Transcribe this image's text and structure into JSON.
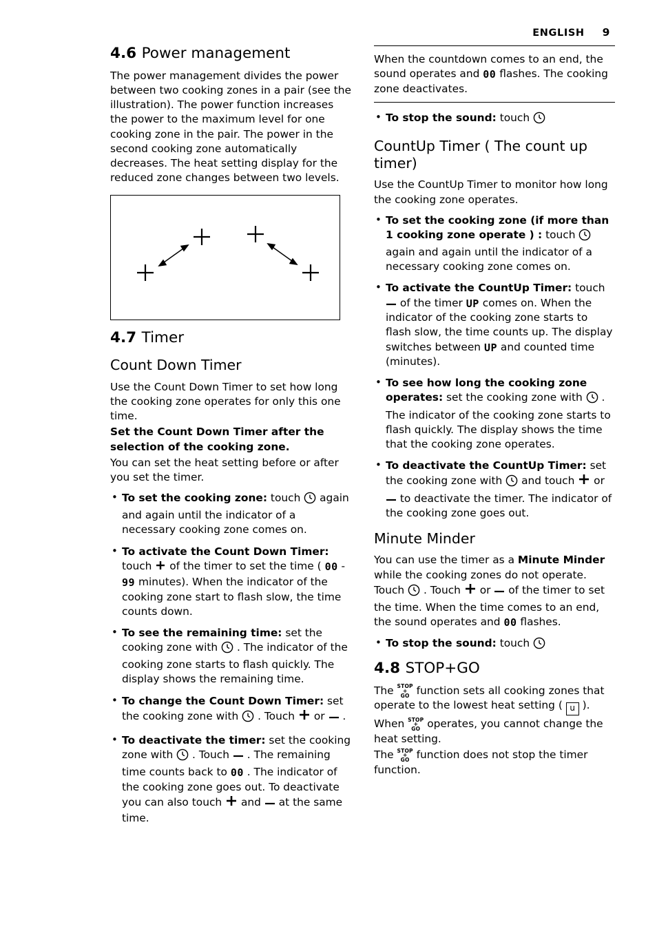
{
  "header": {
    "language": "ENGLISH",
    "page_number": "9"
  },
  "left_column": {
    "section_46": {
      "number": "4.6",
      "title": "Power management",
      "body": "The power management divides the power between two cooking zones in a pair (see the illustration). The power function increases the power to the maximum level for one cooking zone in the pair. The power in the second cooking zone automatically decreases. The heat setting display for the reduced zone changes between two levels.",
      "illustration_name": "power-management-diagram"
    },
    "section_47": {
      "number": "4.7",
      "title": "Timer",
      "subtitle": "Count Down Timer",
      "intro": "Use the Count Down Timer to set how long the cooking zone operates for only this one time.",
      "bold_note": "Set the Count Down Timer after the selection of the cooking zone.",
      "after_note": "You can set the heat setting before or after you set the timer.",
      "bullets": [
        {
          "lead": "To set the cooking zone:",
          "text_1": " touch ",
          "icon_1": "clock-icon",
          "text_2": " again and again until the indicator of a necessary cooking zone comes on."
        },
        {
          "lead": "To activate the Count Down Timer:",
          "text_1": " touch ",
          "icon_1": "plus-icon",
          "text_2": " of the timer to set the time ( ",
          "seg_1": "00",
          "text_3": " - ",
          "seg_2": "99",
          "text_4": " minutes). When the indicator of the cooking zone start to flash slow, the time counts down."
        },
        {
          "lead": "To see the remaining time:",
          "text_1": " set the cooking zone with ",
          "icon_1": "clock-icon",
          "text_2": " . The indicator of the cooking zone starts to flash quickly. The display shows the remaining time."
        },
        {
          "lead": "To change the Count Down Timer:",
          "text_1": " set the cooking zone with ",
          "icon_1": "clock-icon",
          "text_2": " . Touch ",
          "icon_2": "plus-icon",
          "text_3": " or ",
          "icon_3": "minus-icon",
          "text_4": " ."
        },
        {
          "lead": "To deactivate the timer:",
          "text_1": " set the cooking zone with ",
          "icon_1": "clock-icon",
          "text_2": " . Touch ",
          "icon_2": "minus-icon",
          "text_3": " . The remaining time counts back to ",
          "seg_1": "00",
          "text_4": " . The indicator of the cooking zone goes out. To deactivate you can also touch ",
          "icon_3": "plus-icon",
          "text_5": " and ",
          "icon_4": "minus-icon",
          "text_6": " at the same time."
        }
      ]
    }
  },
  "right_column": {
    "note_box": {
      "text_1": "When the countdown comes to an end, the sound operates and ",
      "seg": "00",
      "text_2": " flashes. The cooking zone deactivates."
    },
    "note_bullet": {
      "lead": "To stop the sound:",
      "text_1": " touch ",
      "icon_1": "clock-icon"
    },
    "countup": {
      "title": "CountUp Timer ( The count up timer)",
      "intro": "Use the CountUp Timer to monitor how long the cooking zone operates.",
      "bullets": [
        {
          "lead": "To set the cooking zone (if more than 1 cooking zone operate ) :",
          "text_1": " touch ",
          "icon_1": "clock-icon",
          "text_2": " again and again until the indicator of a necessary cooking zone comes on."
        },
        {
          "lead": "To activate the CountUp Timer:",
          "text_1": " touch ",
          "icon_1": "minus-icon",
          "text_2": " of the timer ",
          "seg_1": "UP",
          "text_3": " comes on. When the indicator of the cooking zone starts to flash slow, the time counts up. The display switches between ",
          "seg_2": "UP",
          "text_4": " and counted time (minutes)."
        },
        {
          "lead": "To see how long the cooking zone operates:",
          "text_1": " set the cooking zone with ",
          "icon_1": "clock-icon",
          "text_2": " . The indicator of the cooking zone starts to flash quickly. The display shows the time that the cooking zone operates."
        },
        {
          "lead": "To deactivate the CountUp Timer:",
          "text_1": " set the cooking zone with ",
          "icon_1": "clock-icon",
          "text_2": " and touch ",
          "icon_2": "plus-icon",
          "text_3": " or ",
          "icon_3": "minus-icon",
          "text_4": " to deactivate the timer. The indicator of the cooking zone goes out."
        }
      ]
    },
    "minute_minder": {
      "title": "Minute Minder",
      "text_1": "You can use the timer as a ",
      "bold_1": "Minute Minder",
      "text_2": " while the cooking zones do not operate. Touch ",
      "icon_1": "clock-icon",
      "text_3": " . Touch ",
      "icon_2": "plus-icon",
      "text_4": " or ",
      "icon_3": "minus-icon",
      "text_5": " of the timer to set the time. When the time comes to an end, the sound operates and ",
      "seg_1": "00",
      "text_6": " flashes.",
      "bullet": {
        "lead": "To stop the sound:",
        "text_1": " touch ",
        "icon_1": "clock-icon"
      }
    },
    "section_48": {
      "number": "4.8",
      "title": "STOP+GO",
      "para_1_a": "The ",
      "icon_1": "stop-go-icon",
      "para_1_b": " function sets all cooking zones that operate to the lowest heat setting ( ",
      "boxed": "u",
      "para_1_c": " ).",
      "para_2_a": "When ",
      "icon_2": "stop-go-icon",
      "para_2_b": " operates, you cannot change the heat setting.",
      "para_3_a": "The ",
      "icon_3": "stop-go-icon",
      "para_3_b": " function does not stop the timer function."
    }
  },
  "icons": {
    "stop_go_line1": "STOP",
    "stop_go_line2": "+",
    "stop_go_line3": "GO"
  }
}
